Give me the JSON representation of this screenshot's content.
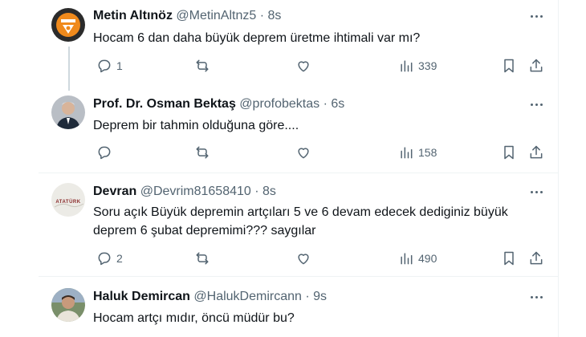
{
  "tweets": [
    {
      "name": "Metin Altınöz",
      "handle": "@MetinAltnz5",
      "separator": "·",
      "time": "8s",
      "text": "Hocam 6 dan daha büyük deprem üretme ihtimali var mı?",
      "replies": "1",
      "retweets": "",
      "likes": "",
      "views": "339",
      "avatar": "team-logo-orange"
    },
    {
      "name": "Prof. Dr. Osman Bektaş",
      "handle": "@profobektas",
      "separator": "·",
      "time": "6s",
      "text": "Deprem bir tahmin olduğuna göre....",
      "replies": "",
      "retweets": "",
      "likes": "",
      "views": "158",
      "avatar": "person-photo-suit"
    },
    {
      "name": "Devran",
      "handle": "@Devrim81658410",
      "separator": "·",
      "time": "8s",
      "text_line1": "Soru açık Büyük depremin artçıları 5 ve 6 devam edecek dediginiz büyük",
      "text_line2": "deprem 6 şubat depremimi??? saygılar",
      "replies": "2",
      "retweets": "",
      "likes": "",
      "views": "490",
      "avatar": "signature-text-avatar",
      "avatar_text": "ATATÜRK"
    },
    {
      "name": "Haluk Demircan",
      "handle": "@HalukDemircann",
      "separator": "·",
      "time": "9s",
      "text": "Hocam artçı mıdır, öncü müdür bu?",
      "avatar": "person-photo-outdoor"
    }
  ],
  "icons": [
    "reply-icon",
    "retweet-icon",
    "like-icon",
    "views-icon",
    "bookmark-icon",
    "share-icon",
    "more-icon"
  ],
  "colors": {
    "text": "#0f1419",
    "secondary": "#536471",
    "divider": "#eff3f4",
    "thread_line": "#cfd9de"
  }
}
